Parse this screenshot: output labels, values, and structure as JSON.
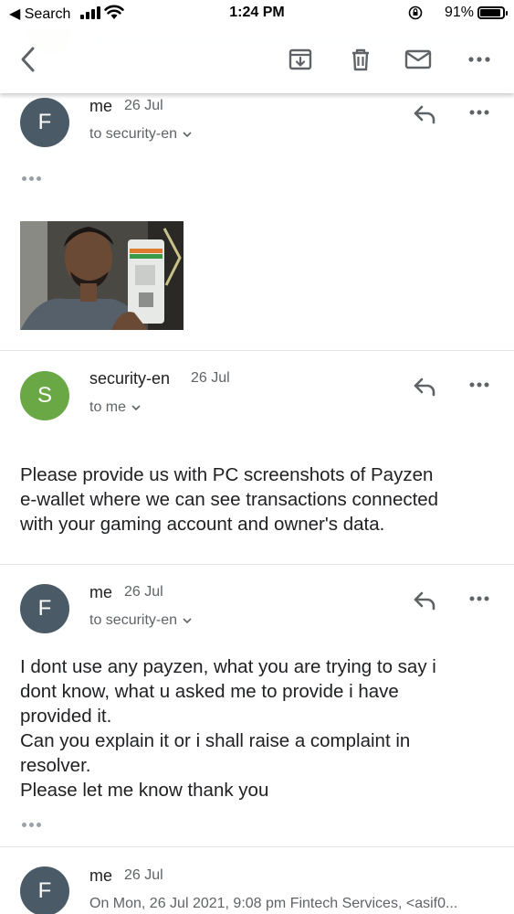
{
  "status_bar": {
    "back_app_label": "◀ Search",
    "time": "1:24 PM",
    "battery": "91%"
  },
  "colors": {
    "avatar_me": "#4a5a66",
    "avatar_security": "#6aa845",
    "icon_gray": "#5f6368"
  },
  "toolbar": {
    "back_icon": "chevron-left-icon",
    "archive_icon": "archive-icon",
    "delete_icon": "trash-icon",
    "mark_unread_icon": "mail-icon",
    "more_icon": "more-horizontal-icon"
  },
  "messages": [
    {
      "avatar": "F",
      "sender": "me",
      "date": "26 Jul",
      "recipient": "to security-en",
      "has_trimmed_content": true,
      "attachment": "photo"
    },
    {
      "avatar": "S",
      "sender": "security-en",
      "date": "26 Jul",
      "recipient": "to me",
      "body": [
        "Please provide us with PC screenshots of Payzen",
        "e-wallet where we can see transactions connected",
        "with your gaming account and owner's data."
      ]
    },
    {
      "avatar": "F",
      "sender": "me",
      "date": "26 Jul",
      "recipient": "to security-en",
      "body": [
        "I dont use any payzen, what you are trying to say i",
        "dont know, what u asked me to provide i have",
        "provided it.",
        "Can you explain it or i shall raise a complaint in",
        "resolver.",
        "Please let me know thank you"
      ],
      "has_trimmed_content": true
    },
    {
      "avatar": "F",
      "sender": "me",
      "date": "26 Jul",
      "preview": "On Mon, 26 Jul 2021, 9:08 pm Fintech Services, <asif0..."
    }
  ]
}
